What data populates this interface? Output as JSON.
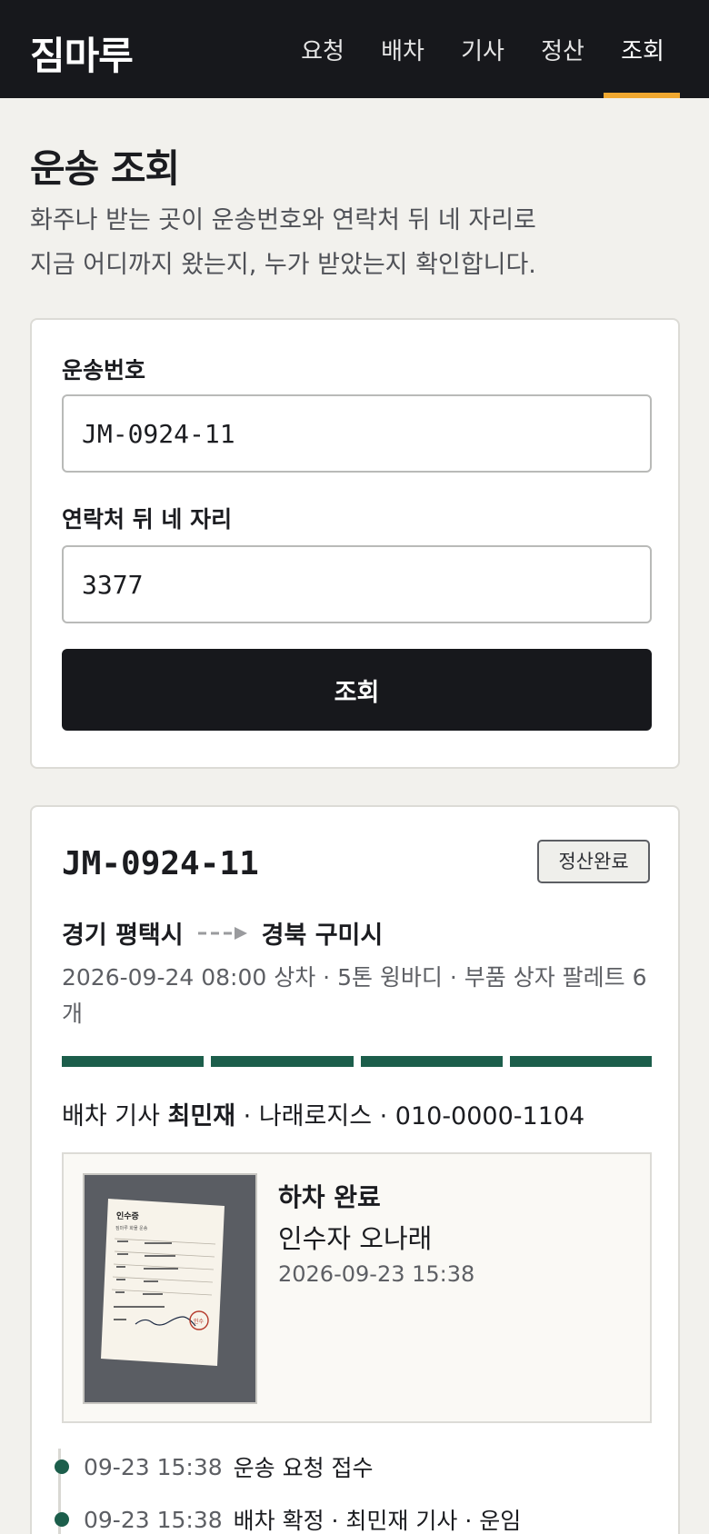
{
  "app": {
    "brand": "짐마루",
    "nav": [
      "요청",
      "배차",
      "기사",
      "정산",
      "조회"
    ],
    "active_nav": "조회"
  },
  "colors": {
    "header_bg": "#17181c",
    "accent": "#f0a830",
    "progress": "#1c5e4b",
    "page_bg": "#f2f1ed"
  },
  "page": {
    "title": "운송 조회",
    "desc_line1": "화주나 받는 곳이 운송번호와 연락처 뒤 네 자리로",
    "desc_line2": "지금 어디까지 왔는지, 누가 받았는지 확인합니다."
  },
  "form": {
    "tracking_label": "운송번호",
    "tracking_value": "JM-0924-11",
    "phone_label": "연락처 뒤 네 자리",
    "phone_value": "3377",
    "submit_label": "조회"
  },
  "result": {
    "tracking_no": "JM-0924-11",
    "status_badge": "정산완료",
    "origin": "경기 평택시",
    "destination": "경북 구미시",
    "meta": "2026-09-24 08:00 상차 · 5톤 윙바디 · 부품 상자 팔레트 6개",
    "progress_steps_total": 4,
    "progress_steps_done": 4,
    "driver_prefix": "배차 기사",
    "driver_name": "최민재",
    "driver_suffix": "· 나래로지스 · 010-0000-1104",
    "pod": {
      "status": "하차 완료",
      "receiver": "인수자 오나래",
      "time": "2026-09-23 15:38",
      "photo": {
        "doc_title": "인수증",
        "doc_subtitle": "짐마루 화물 운송",
        "stamp": "인수"
      }
    },
    "timeline": [
      {
        "time": "09-23 15:38",
        "text": "운송 요청 접수"
      },
      {
        "time": "09-23 15:38",
        "text": "배차 확정 · 최민재 기사 · 운임"
      }
    ]
  }
}
